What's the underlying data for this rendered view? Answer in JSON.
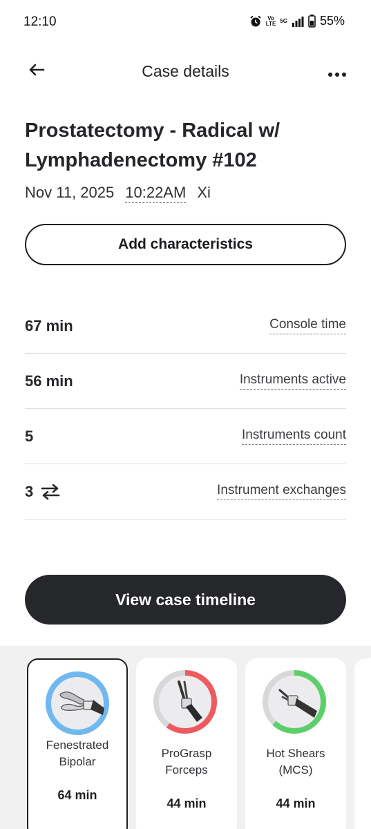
{
  "status_bar": {
    "time": "12:10",
    "battery": "55%",
    "network": "5G",
    "volte": "Vo LTE"
  },
  "header": {
    "title": "Case details"
  },
  "case": {
    "title": "Prostatectomy - Radical w/ Lymphadenectomy #102",
    "date": "Nov 11, 2025",
    "time": "10:22AM",
    "system": "Xi"
  },
  "add_button_label": "Add characteristics",
  "stats": [
    {
      "value": "67 min",
      "label": "Console time"
    },
    {
      "value": "56 min",
      "label": "Instruments active"
    },
    {
      "value": "5",
      "label": "Instruments count"
    },
    {
      "value": "3",
      "label": "Instrument exchanges",
      "icon": "swap-arrows-icon"
    }
  ],
  "timeline_button_label": "View case timeline",
  "instruments": [
    {
      "name_line1": "Fenestrated",
      "name_line2": "Bipolar",
      "duration": "64 min",
      "ring_color": "#6fb8f0",
      "ring_fraction": 1.0,
      "selected": true
    },
    {
      "name_line1": "ProGrasp",
      "name_line2": "Forceps",
      "duration": "44 min",
      "ring_color": "#ee5a5f",
      "ring_fraction": 0.6,
      "selected": false
    },
    {
      "name_line1": "Hot Shears",
      "name_line2": "(MCS)",
      "duration": "44 min",
      "ring_color": "#5dcf6a",
      "ring_fraction": 0.62,
      "selected": false
    }
  ],
  "colors": {
    "dark": "#26272b",
    "ring_track": "#d8d8da"
  }
}
